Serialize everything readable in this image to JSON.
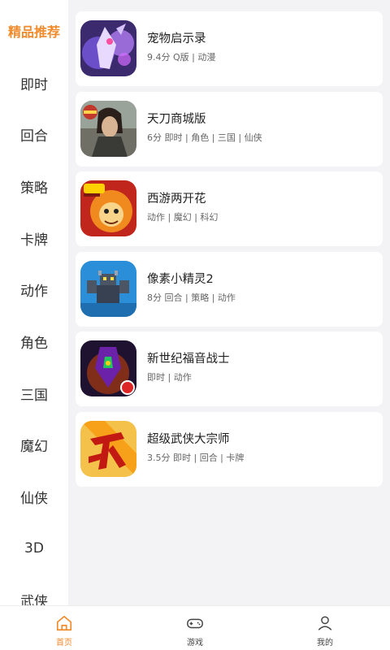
{
  "colors": {
    "accent": "#f08a2b",
    "text": "#333333",
    "muted": "#666666",
    "background": "#f3f3f5"
  },
  "sidebar": {
    "categories": [
      {
        "label": "精品推荐",
        "active": true
      },
      {
        "label": "即时"
      },
      {
        "label": "回合"
      },
      {
        "label": "策略"
      },
      {
        "label": "卡牌"
      },
      {
        "label": "动作"
      },
      {
        "label": "角色"
      },
      {
        "label": "三国"
      },
      {
        "label": "魔幻"
      },
      {
        "label": "仙侠"
      },
      {
        "label": "3D"
      },
      {
        "label": "武侠"
      }
    ]
  },
  "games": [
    {
      "title": "宠物启示录",
      "meta": "9.4分 Q版 | 动漫",
      "icon": "purple-creature-icon"
    },
    {
      "title": "天刀商城版",
      "meta": "6分 即时 | 角色 | 三国 | 仙侠",
      "icon": "swordsman-icon"
    },
    {
      "title": "西游两开花",
      "meta": "动作 | 魔幻 | 科幻",
      "icon": "monkey-king-icon"
    },
    {
      "title": "像素小精灵2",
      "meta": "8分 回合 | 策略 | 动作",
      "icon": "pixel-dragon-icon"
    },
    {
      "title": "新世纪福音战士",
      "meta": "即时 | 动作",
      "icon": "mecha-icon"
    },
    {
      "title": "超级武侠大宗师",
      "meta": "3.5分 即时 | 回合 | 卡牌",
      "icon": "wu-character-icon"
    }
  ],
  "tabbar": {
    "tabs": [
      {
        "label": "首页",
        "icon": "home-icon",
        "active": true
      },
      {
        "label": "游戏",
        "icon": "gamepad-icon"
      },
      {
        "label": "我的",
        "icon": "user-icon"
      }
    ]
  }
}
